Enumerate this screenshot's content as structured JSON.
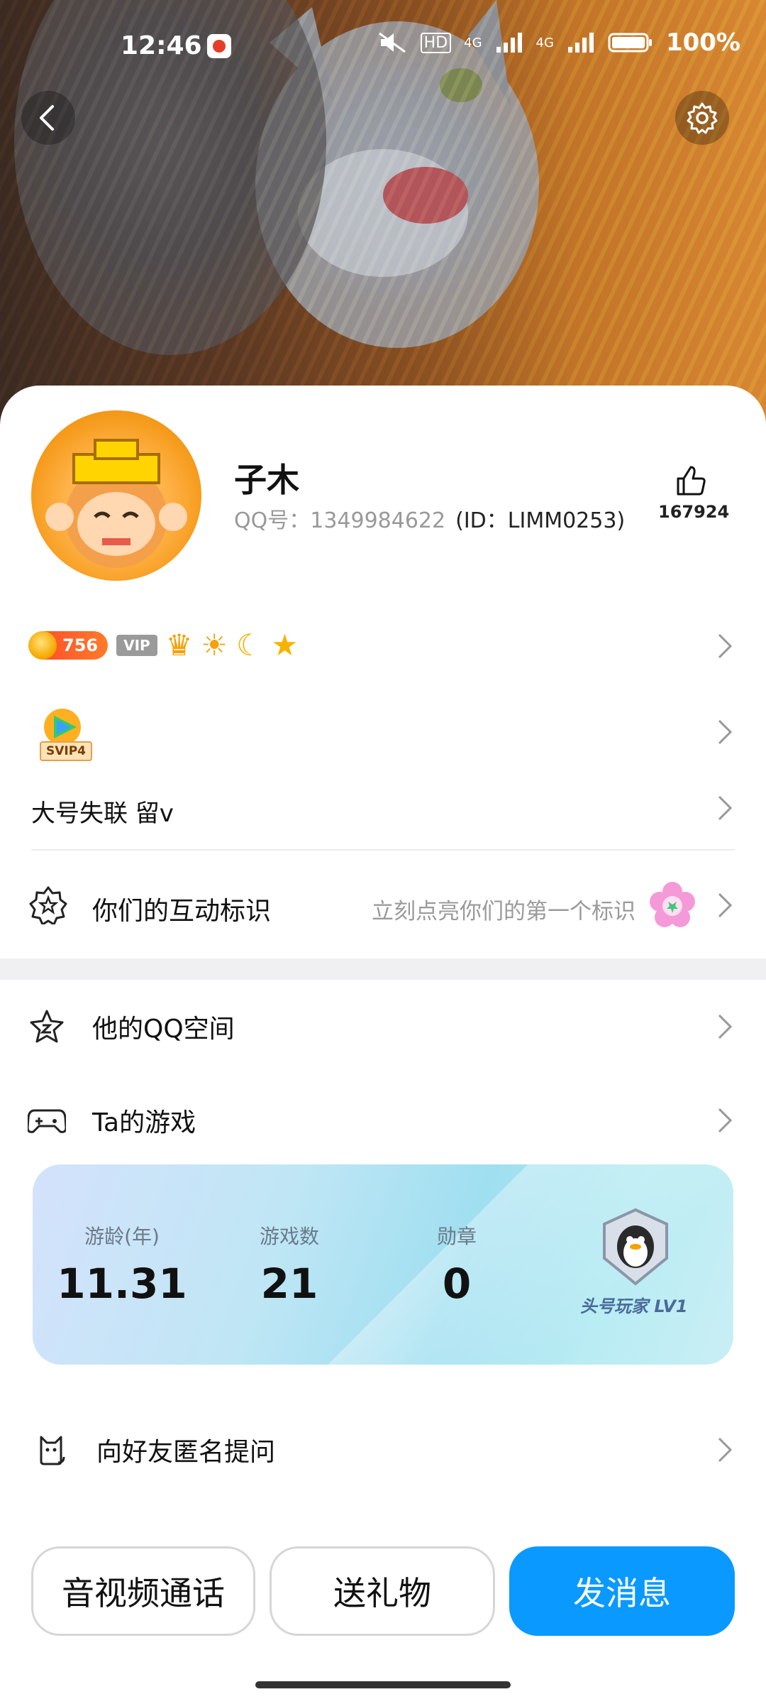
{
  "status_bar": {
    "time": "12:46",
    "battery_percent": "100%",
    "network_labels": [
      "HD",
      "4G",
      "4G"
    ]
  },
  "profile": {
    "name": "子木",
    "qq_label": "QQ号：1349984622",
    "id_label": "(ID：LIMM0253)",
    "like_count": "167924"
  },
  "badges": {
    "coin_count": "756",
    "vip_label": "VIP",
    "icons": [
      "crown-icon",
      "sun-icon",
      "moon-icon",
      "star-icon"
    ]
  },
  "svip": {
    "label": "SVIP4"
  },
  "signature": "大号失联 留v",
  "interaction": {
    "label": "你们的互动标识",
    "hint": "立刻点亮你们的第一个标识"
  },
  "menu": {
    "qzone": "他的QQ空间",
    "games": "Ta的游戏",
    "ask": "向好友匿名提问"
  },
  "game_stats": {
    "items": [
      {
        "label": "游龄(年)",
        "value": "11.31"
      },
      {
        "label": "游戏数",
        "value": "21"
      },
      {
        "label": "勋章",
        "value": "0"
      }
    ],
    "level_label": "头号玩家 LV1"
  },
  "actions": {
    "call": "音视频通话",
    "gift": "送礼物",
    "message": "发消息"
  },
  "colors": {
    "primary": "#0a99ff",
    "coin_badge": "#ff5a2a",
    "muted": "#9a9a9a"
  }
}
